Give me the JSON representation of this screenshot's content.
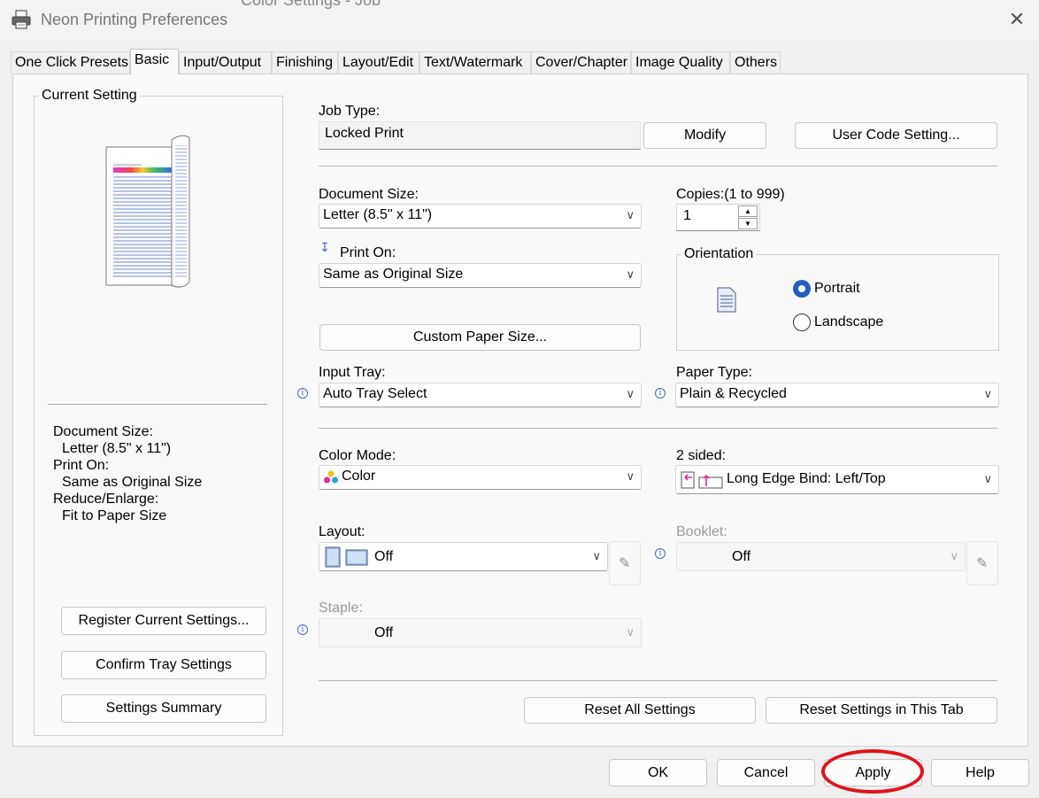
{
  "window": {
    "title": "Neon Printing Preferences",
    "behind_text": "Color Settings - Job",
    "close_label": "✕"
  },
  "tabs": [
    {
      "label": "One Click Presets"
    },
    {
      "label": "Basic",
      "active": true
    },
    {
      "label": "Input/Output"
    },
    {
      "label": "Finishing"
    },
    {
      "label": "Layout/Edit"
    },
    {
      "label": "Text/Watermark"
    },
    {
      "label": "Cover/Chapter"
    },
    {
      "label": "Image Quality"
    },
    {
      "label": "Others"
    }
  ],
  "current_setting": {
    "group_label": "Current Setting",
    "summary": [
      "Document Size:",
      "Letter (8.5\" x 11\")",
      "Print On:",
      "Same as Original Size",
      "Reduce/Enlarge:",
      "Fit to Paper Size"
    ],
    "buttons": {
      "register": "Register Current Settings...",
      "confirm_tray": "Confirm Tray Settings",
      "summary": "Settings Summary"
    }
  },
  "job": {
    "label": "Job Type:",
    "value": "Locked Print",
    "modify": "Modify",
    "user_code": "User Code Setting..."
  },
  "document_size": {
    "label": "Document Size:",
    "value": "Letter (8.5\" x 11\")"
  },
  "copies": {
    "label": "Copies:(1 to 999)",
    "value": "1"
  },
  "print_on": {
    "label": "Print On:",
    "value": "Same as Original Size"
  },
  "orientation": {
    "label": "Orientation",
    "portrait": "Portrait",
    "landscape": "Landscape",
    "selected": "Portrait"
  },
  "custom_paper_size": "Custom Paper Size...",
  "input_tray": {
    "label": "Input Tray:",
    "value": "Auto Tray Select"
  },
  "paper_type": {
    "label": "Paper Type:",
    "value": "Plain & Recycled"
  },
  "color_mode": {
    "label": "Color Mode:",
    "value": "Color"
  },
  "two_sided": {
    "label": "2 sided:",
    "value": "Long Edge Bind: Left/Top"
  },
  "layout": {
    "label": "Layout:",
    "value": "Off"
  },
  "booklet": {
    "label": "Booklet:",
    "value": "Off"
  },
  "staple": {
    "label": "Staple:",
    "value": "Off"
  },
  "reset": {
    "all": "Reset All Settings",
    "tab": "Reset Settings in This Tab"
  },
  "dialog_buttons": {
    "ok": "OK",
    "cancel": "Cancel",
    "apply": "Apply",
    "help": "Help"
  },
  "colors": {
    "accent": "#1f5fbf",
    "highlight": "#e0141c"
  }
}
